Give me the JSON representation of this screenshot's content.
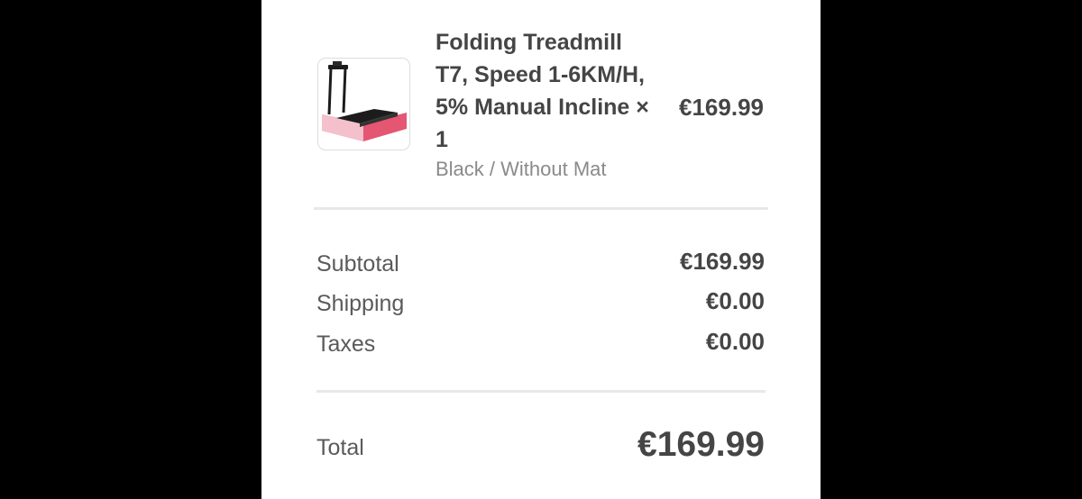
{
  "product": {
    "image_icon": "treadmill-product-image",
    "title": "Folding Treadmill T7, Speed 1-6KM/H, 5% Manual Incline × 1",
    "variant": "Black / Without Mat",
    "price": "€169.99"
  },
  "summary": {
    "subtotal_label": "Subtotal",
    "subtotal_value": "€169.99",
    "shipping_label": "Shipping",
    "shipping_value": "€0.00",
    "taxes_label": "Taxes",
    "taxes_value": "€0.00"
  },
  "total": {
    "label": "Total",
    "value": "€169.99"
  },
  "colors": {
    "background": "#000000",
    "panel": "#ffffff",
    "text_primary": "#454545",
    "text_secondary": "#8a8a8a",
    "divider": "#e8e8e8",
    "product_accent": "#e0385a"
  }
}
